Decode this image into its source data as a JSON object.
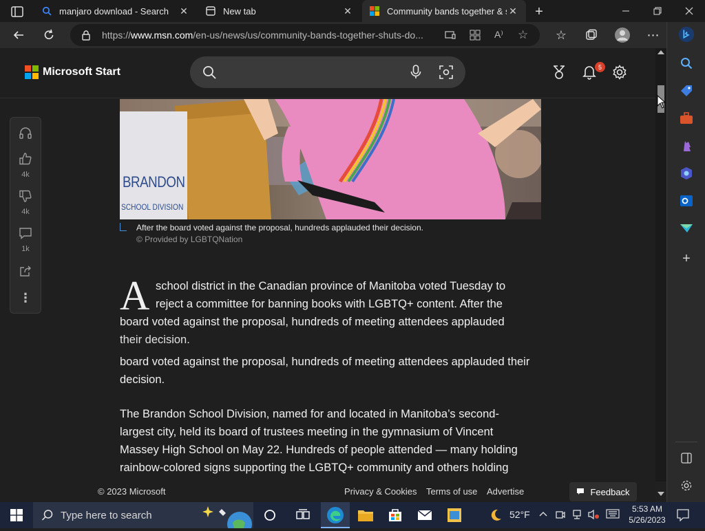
{
  "browser": {
    "tabs": [
      {
        "title": "manjaro download - Search",
        "active": false
      },
      {
        "title": "New tab",
        "active": false
      },
      {
        "title": "Community bands together & sh",
        "active": true
      }
    ],
    "url_prefix": "https://",
    "url_domain": "www.msn.com",
    "url_path": "/en-us/news/us/community-bands-together-shuts-do..."
  },
  "header": {
    "brand": "Microsoft Start",
    "notification_count": "5"
  },
  "rail": {
    "likes": "4k",
    "dislikes": "4k",
    "comments": "1k"
  },
  "article": {
    "caption": "After the board voted against the proposal, hundreds applauded their decision.",
    "credit": "© Provided by LGBTQNation",
    "dropcap": "A",
    "para1": "school district in the Canadian province of Manitoba voted Tuesday to reject a committee for banning books with LGBTQ+ content. After the",
    "para1b": "board voted against the proposal, hundreds of meeting attendees applauded",
    "para1c": "their decision.",
    "para2": "board voted against the proposal, hundreds of meeting attendees applauded their decision.",
    "para3": "The Brandon School Division, named for and located in Manitoba’s second-largest city, held its board of trustees meeting in the gymnasium of Vincent Massey High School on May 22. Hundreds of people attended — many holding rainbow-colored signs supporting the LGBTQ+ community and others holding",
    "image_sign_line1": "BRANDON",
    "image_sign_line2": "SCHOOL DIVISION"
  },
  "footer": {
    "copyright": "© 2023 Microsoft",
    "privacy": "Privacy & Cookies",
    "terms": "Terms of use",
    "advertise": "Advertise",
    "feedback": "Feedback"
  },
  "taskbar": {
    "search_placeholder": "Type here to search",
    "weather": "52°F",
    "time": "5:53 AM",
    "date": "5/26/2023"
  },
  "colors": {
    "accent": "#0078d4",
    "badge": "#d7402a"
  }
}
